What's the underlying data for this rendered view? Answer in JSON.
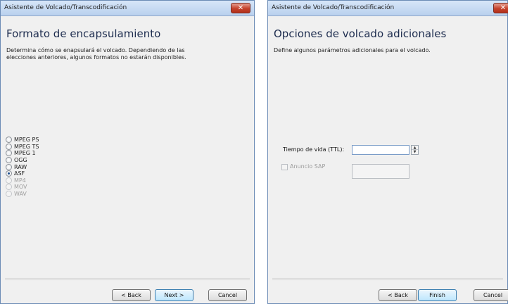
{
  "left_window": {
    "title": "Asistente de Volcado/Transcodificación",
    "close_label": "✕",
    "heading": "Formato de encapsulamiento",
    "description": "Determina cómo se enapsulará el volcado. Dependiendo de las elecciones anteriores, algunos formatos no estarán disponibles.",
    "formats": [
      {
        "label": "MPEG PS",
        "checked": false,
        "enabled": true
      },
      {
        "label": "MPEG TS",
        "checked": false,
        "enabled": true
      },
      {
        "label": "MPEG 1",
        "checked": false,
        "enabled": true
      },
      {
        "label": "OGG",
        "checked": false,
        "enabled": true
      },
      {
        "label": "RAW",
        "checked": false,
        "enabled": true
      },
      {
        "label": "ASF",
        "checked": true,
        "enabled": true
      },
      {
        "label": "MP4",
        "checked": false,
        "enabled": false
      },
      {
        "label": "MOV",
        "checked": false,
        "enabled": false
      },
      {
        "label": "WAV",
        "checked": false,
        "enabled": false
      }
    ],
    "buttons": {
      "back": "< Back",
      "next": "Next >",
      "cancel": "Cancel"
    }
  },
  "right_window": {
    "title": "Asistente de Volcado/Transcodificación",
    "close_label": "✕",
    "heading": "Opciones de volcado adicionales",
    "description": "Define algunos parámetros adicionales para el volcado.",
    "ttl_label": "Tiempo de vida (TTL):",
    "ttl_value": "",
    "sap_label": "Anuncio SAP",
    "sap_checked": false,
    "sap_value": "",
    "buttons": {
      "back": "< Back",
      "finish": "Finish",
      "cancel": "Cancel"
    }
  },
  "icons": {
    "close": "close-icon",
    "spin_up": "spin-up-icon",
    "spin_down": "spin-down-icon"
  },
  "colors": {
    "titlebar": "#c6daf2",
    "close": "#c4412b",
    "heading": "#1e2d4f",
    "default_button": "#bee6fd"
  }
}
